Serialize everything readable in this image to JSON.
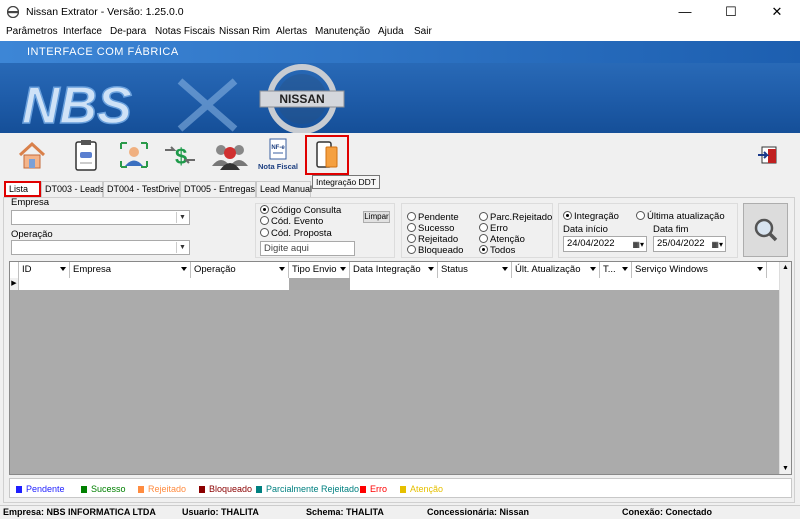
{
  "window": {
    "title": "Nissan Extrator - Versão: 1.25.0.0",
    "minimize": "—",
    "maximize": "☐",
    "close": "✕"
  },
  "menu": [
    "Parâmetros",
    "Interface",
    "De-para",
    "Notas Fiscais",
    "Nissan Rim",
    "Alertas",
    "Manutenção",
    "Ajuda",
    "Sair"
  ],
  "banner": {
    "title": "INTERFACE COM FÁBRICA",
    "logo_left": "NBS",
    "logo_right": "NISSAN"
  },
  "toolbar": {
    "nota_fiscal_label": "Nota Fiscal",
    "tooltip": "Integração DDT",
    "nfe_tag": "NF-e"
  },
  "tabs": [
    "Lista",
    "DT003 - Leads",
    "DT004 - TestDrive",
    "DT005 - Entregas",
    "Lead Manual"
  ],
  "filters": {
    "empresa_label": "Empresa",
    "empresa_value": "",
    "operacao_label": "Operação",
    "operacao_value": "",
    "codigo_options": [
      "Código Consulta",
      "Cód. Evento",
      "Cód. Proposta"
    ],
    "limpar": "Limpar",
    "search_placeholder": "Digite aqui",
    "status_options": [
      "Pendente",
      "Sucesso",
      "Rejeitado",
      "Bloqueado",
      "Parc.Rejeitado",
      "Erro",
      "Atenção",
      "Todos"
    ],
    "date_type_options": [
      "Integração",
      "Última atualização"
    ],
    "data_inicio_label": "Data início",
    "data_inicio": "24/04/2022",
    "data_fim_label": "Data fim",
    "data_fim": "25/04/2022"
  },
  "grid": {
    "columns": [
      "ID",
      "Empresa",
      "Operação",
      "Tipo Envio",
      "Data Integração",
      "Status",
      "Últ. Atualização",
      "T...",
      "Serviço Windows"
    ]
  },
  "legend": [
    {
      "label": "Pendente",
      "color": "#1f1fff"
    },
    {
      "label": "Sucesso",
      "color": "#008000"
    },
    {
      "label": "Rejeitado",
      "color": "#ff8c40"
    },
    {
      "label": "Bloqueado",
      "color": "#8b0000"
    },
    {
      "label": "Parcialmente Rejeitado",
      "color": "#008080"
    },
    {
      "label": "Erro",
      "color": "#ff0000"
    },
    {
      "label": "Atenção",
      "color": "#e6c000"
    }
  ],
  "status": {
    "empresa": "Empresa: NBS INFORMATICA LTDA",
    "usuario": "Usuario: THALITA",
    "schema": "Schema: THALITA",
    "concessionaria": "Concessionária: Nissan",
    "conexao": "Conexão: Conectado"
  }
}
